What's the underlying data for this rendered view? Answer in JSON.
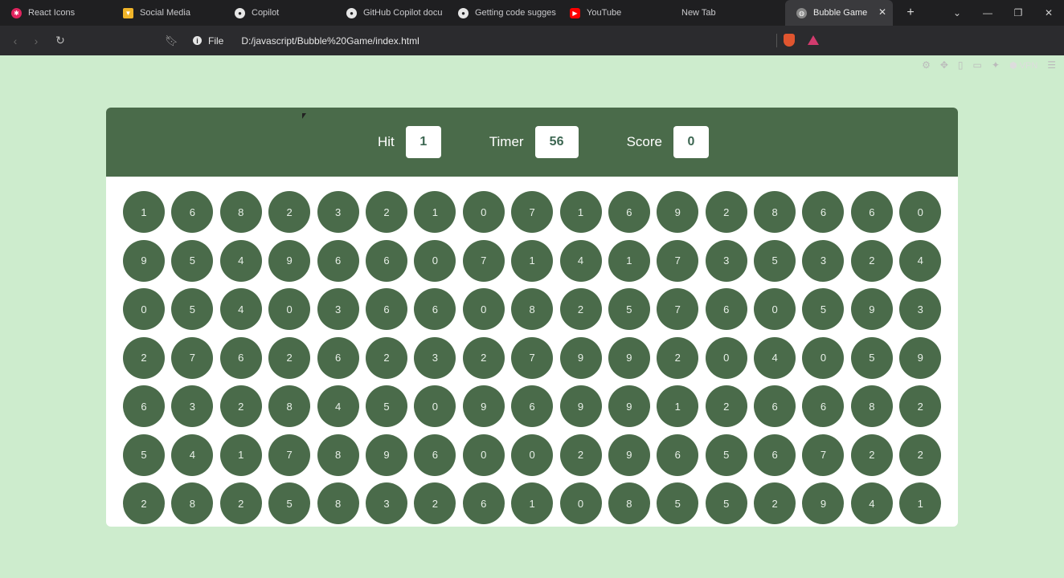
{
  "tabs": [
    {
      "label": "React Icons",
      "icon": "react-icon",
      "color": "#e0245e"
    },
    {
      "label": "Social Media",
      "icon": "vue-icon",
      "color": "#f0b429"
    },
    {
      "label": "Copilot",
      "icon": "github-icon",
      "color": "#e6e6e6"
    },
    {
      "label": "GitHub Copilot docu",
      "icon": "github-icon",
      "color": "#e6e6e6"
    },
    {
      "label": "Getting code sugges",
      "icon": "github-icon",
      "color": "#e6e6e6"
    },
    {
      "label": "YouTube",
      "icon": "youtube-icon",
      "color": "#ff0000"
    },
    {
      "label": "New Tab",
      "icon": "",
      "color": ""
    }
  ],
  "active_tab": {
    "label": "Bubble Game",
    "icon": "globe-icon"
  },
  "address": {
    "scheme_label": "File",
    "url": "D:/javascript/Bubble%20Game/index.html"
  },
  "toolbar": {
    "vpn_label": "VPN"
  },
  "game": {
    "hit_label": "Hit",
    "hit_value": "1",
    "timer_label": "Timer",
    "timer_value": "56",
    "score_label": "Score",
    "score_value": "0",
    "colors": {
      "panel": "#4a6b4a",
      "background": "#cdeccd",
      "bubble": "#4a6b4a"
    },
    "bubbles": [
      [
        1,
        6,
        8,
        2,
        3,
        2,
        1,
        0,
        7,
        1,
        6,
        9,
        2,
        8,
        6,
        6,
        0
      ],
      [
        9,
        5,
        4,
        9,
        6,
        6,
        0,
        7,
        1,
        4,
        1,
        7,
        3,
        5,
        3,
        2,
        4
      ],
      [
        0,
        5,
        4,
        0,
        3,
        6,
        6,
        0,
        8,
        2,
        5,
        7,
        6,
        0,
        5,
        9,
        3
      ],
      [
        2,
        7,
        6,
        2,
        6,
        2,
        3,
        2,
        7,
        9,
        9,
        2,
        0,
        4,
        0,
        5,
        9
      ],
      [
        6,
        3,
        2,
        8,
        4,
        5,
        0,
        9,
        6,
        9,
        9,
        1,
        2,
        6,
        6,
        8,
        2
      ],
      [
        5,
        4,
        1,
        7,
        8,
        9,
        6,
        0,
        0,
        2,
        9,
        6,
        5,
        6,
        7,
        2,
        2
      ],
      [
        2,
        8,
        2,
        5,
        8,
        3,
        2,
        6,
        1,
        0,
        8,
        5,
        5,
        2,
        9,
        4,
        1
      ]
    ]
  }
}
